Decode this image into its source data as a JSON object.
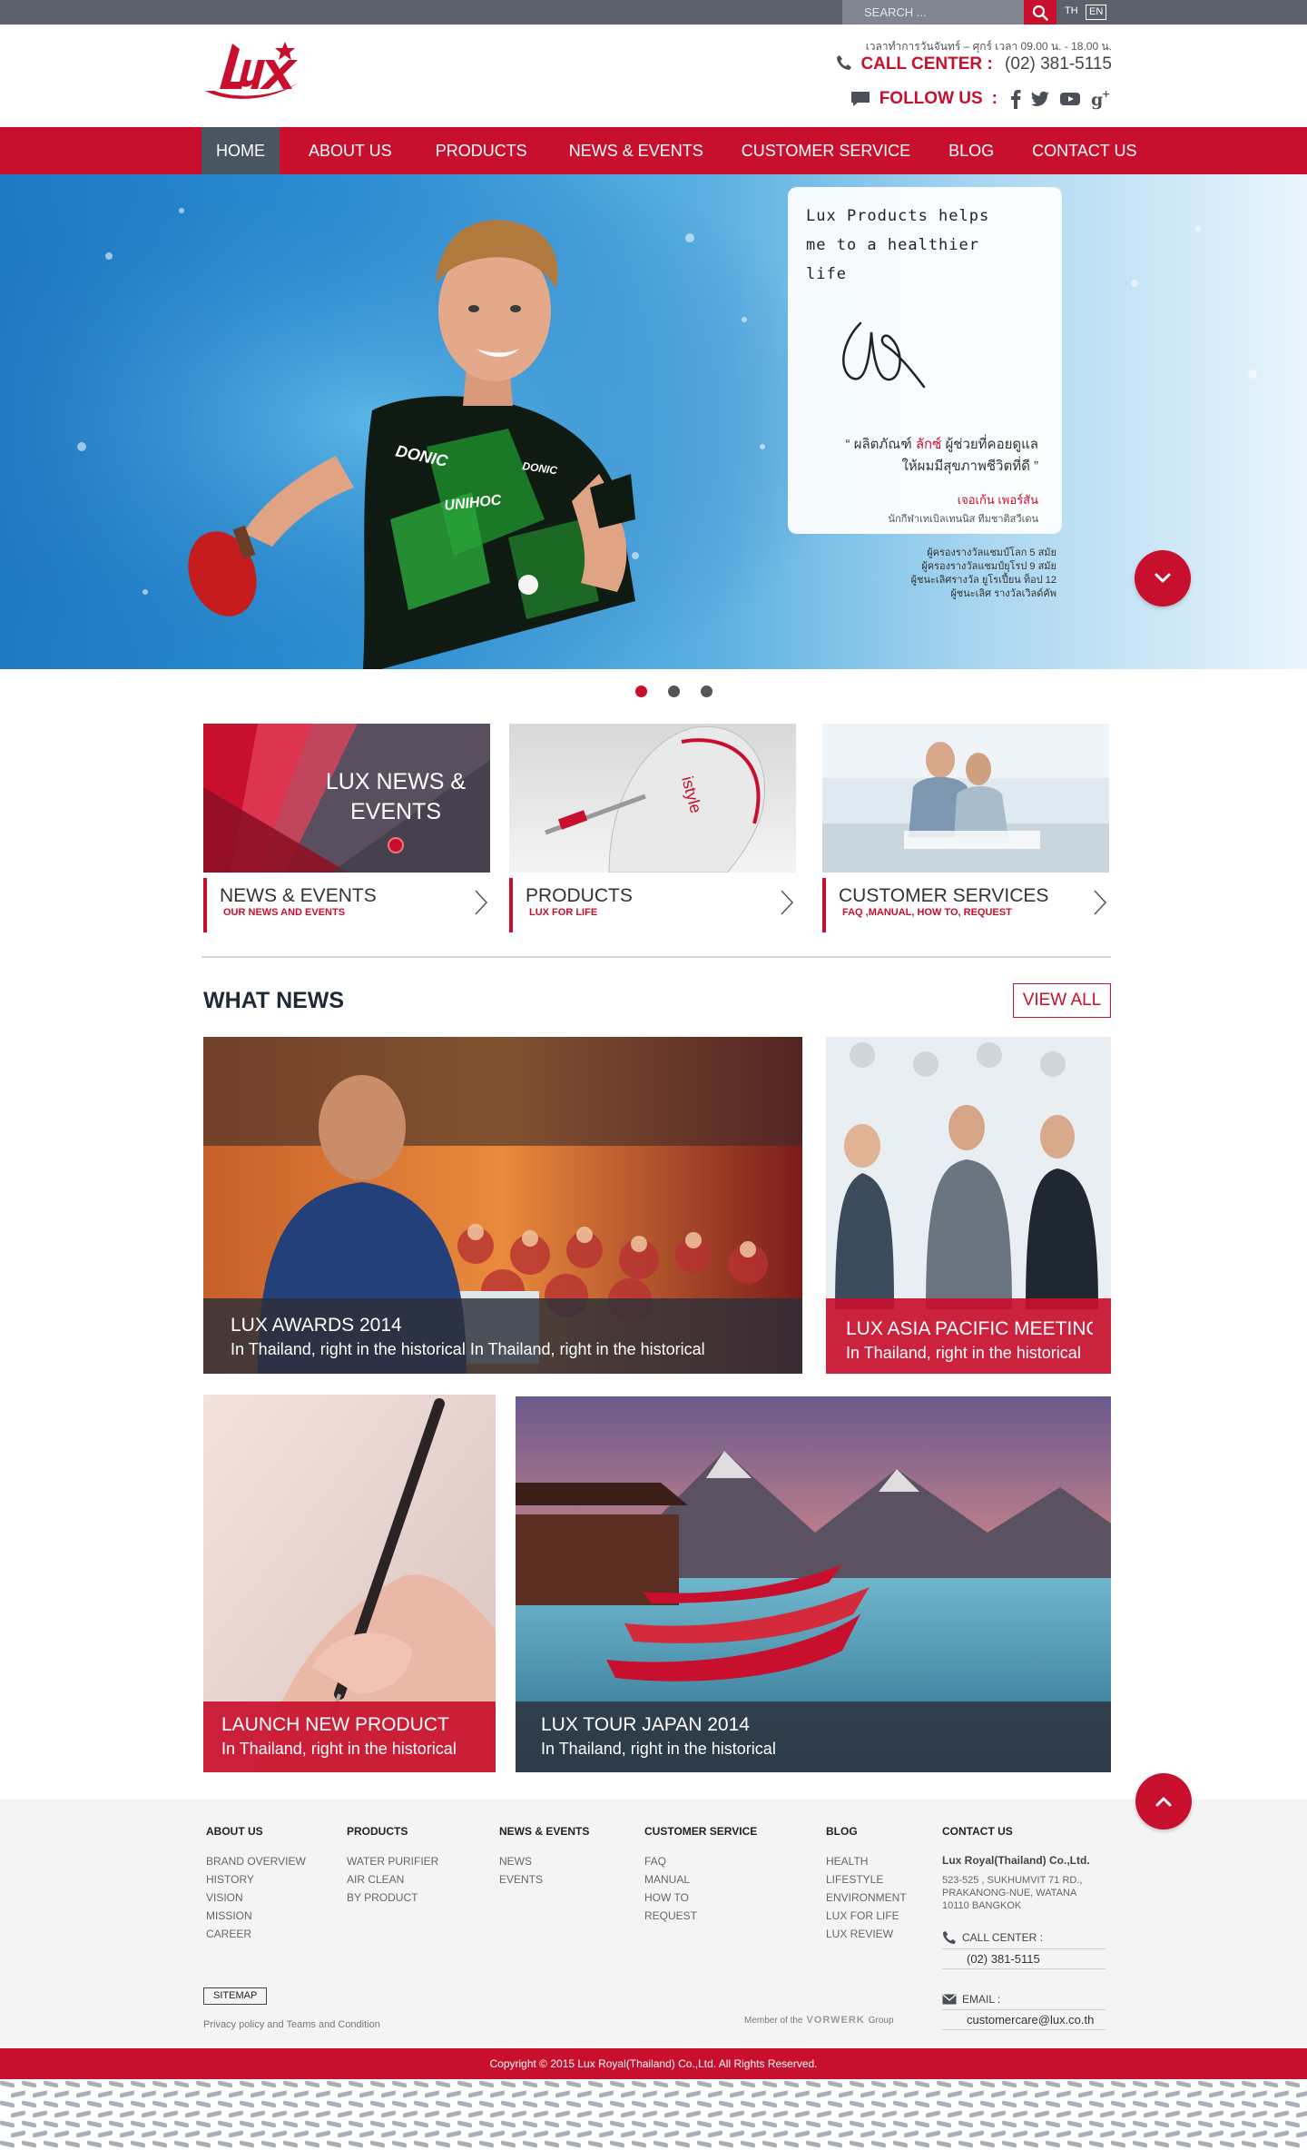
{
  "topbar": {
    "search_placeholder": "SEARCH ...",
    "lang_th": "TH",
    "lang_en": "EN"
  },
  "header": {
    "logo_text": "Lux",
    "hours": "เวลาทำการวันจันทร์ – ศุกร์ เวลา 09.00 น. - 18.00 น.",
    "call_label": "CALL CENTER",
    "call_colon": ":",
    "call_number": "(02) 381-5115",
    "follow_label": "FOLLOW US",
    "follow_colon": ":",
    "social_icons": [
      "facebook-icon",
      "twitter-icon",
      "youtube-icon",
      "google-plus-icon"
    ]
  },
  "nav": {
    "items": [
      "HOME",
      "ABOUT US",
      "PRODUCTS",
      "NEWS & EVENTS",
      "CUSTOMER SERVICE",
      "BLOG",
      "CONTACT US"
    ],
    "active_index": 0
  },
  "hero": {
    "quote_lines": [
      "Lux Products helps",
      "me to a healthier",
      "life"
    ],
    "thai_line1_a": "ผลิตภัณฑ์",
    "thai_line1_hl": "ลักซ์",
    "thai_line1_b": "ผู้ช่วยที่คอยดูแล",
    "thai_line2": "ให้ผมมีสุขภาพชีวิตที่ดี",
    "name": "เจอเก้น เพอร์สัน",
    "subtitle": "นักกีฬาเทเบิลเทนนิส ทีมชาติสวีเดน",
    "achievements": [
      "ผู้ครองรางวัลแชมป์โลก 5 สมัย",
      "ผู้ครองรางวัลแชมป์ยุโรป 9 สมัย",
      "ผู้ชนะเลิศรางวัล ยูโรเปี้ยน ท็อป 12",
      "ผู้ชนะเลิศ รางวัลเวิลด์คัพ"
    ],
    "jersey_brand_1": "DONIC",
    "jersey_brand_2": "DONIC",
    "jersey_brand_3": "UNIHOC",
    "slides": 3,
    "active_slide": 0
  },
  "cards": [
    {
      "title": "NEWS & EVENTS",
      "sub": "OUR NEWS AND EVENTS",
      "image_text": "LUX NEWS &\nEVENTS",
      "image_line1": "LUX NEWS &",
      "image_line2": "EVENTS"
    },
    {
      "title": "PRODUCTS",
      "sub": "LUX FOR LIFE",
      "image_text": "istyle"
    },
    {
      "title": "CUSTOMER SERVICES",
      "sub": "FAQ ,MANUAL, HOW TO, REQUEST"
    }
  ],
  "what_news": {
    "title": "WHAT NEWS",
    "view_all": "VIEW ALL",
    "items": [
      {
        "title": "LUX AWARDS 2014",
        "desc": "In Thailand, right in the historical  In Thailand, right in the historical"
      },
      {
        "title": "LUX ASIA PACIFIC MEETING",
        "desc": "In Thailand, right in the historical"
      },
      {
        "title": "LAUNCH NEW PRODUCT",
        "desc": "In Thailand, right in the historical"
      },
      {
        "title": "LUX TOUR JAPAN 2014",
        "desc": "In Thailand, right in the historical"
      }
    ]
  },
  "footer": {
    "columns": [
      {
        "head": "ABOUT US",
        "links": [
          "BRAND OVERVIEW",
          "HISTORY",
          "VISION",
          "MISSION",
          "CAREER"
        ]
      },
      {
        "head": "PRODUCTS",
        "links": [
          "WATER PURIFIER",
          "AIR CLEAN",
          "BY PRODUCT"
        ]
      },
      {
        "head": "NEWS & EVENTS",
        "links": [
          "NEWS",
          "EVENTS"
        ]
      },
      {
        "head": "CUSTOMER  SERVICE",
        "links": [
          "FAQ",
          "MANUAL",
          "HOW TO",
          "REQUEST"
        ]
      },
      {
        "head": "BLOG",
        "links": [
          "HEALTH",
          "LIFESTYLE",
          "ENVIRONMENT",
          "LUX FOR LIFE",
          "LUX REVIEW"
        ]
      }
    ],
    "contact": {
      "head": "CONTACT US",
      "company": "Lux Royal(Thailand) Co.,Ltd.",
      "address": [
        "523-525 , SUKHUMVIT 71 RD.,",
        "PRAKANONG-NUE, WATANA",
        "10110 BANGKOK"
      ],
      "call_label": "CALL CENTER :",
      "call_value": "(02) 381-5115",
      "email_label": "EMAIL :",
      "email_value": "customercare@lux.co.th"
    },
    "sitemap": "SITEMAP",
    "privacy": "Privacy policy and Teams and Condition",
    "member_prefix": "Member of the",
    "member_brand": "VORWERK",
    "member_suffix": "Group",
    "copyright": "Copyright  © 2015  Lux Royal(Thailand) Co.,Ltd. All Rights Reserved."
  },
  "colors": {
    "brand_red": "#c8102e",
    "nav_active": "#4a5562",
    "topbar": "#5c626b"
  }
}
